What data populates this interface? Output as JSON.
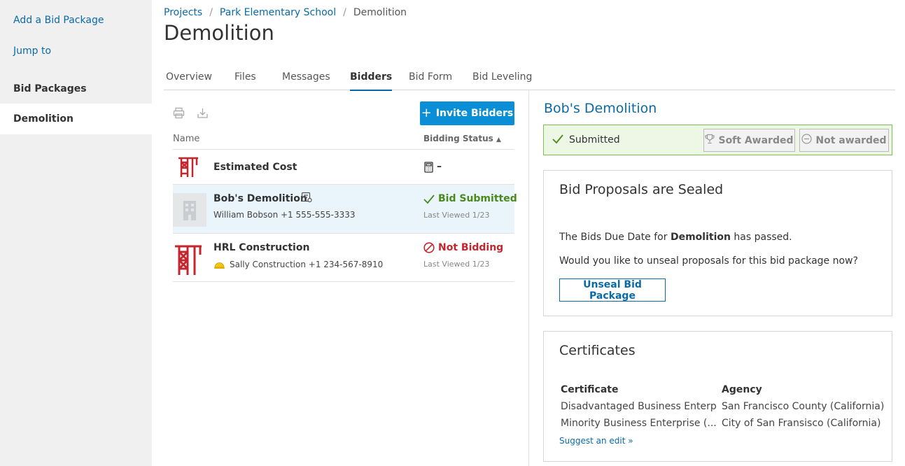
{
  "sidebar": {
    "add_link": "Add a Bid Package",
    "jump_link": "Jump to",
    "section_label": "Bid Packages",
    "active_item": "Demolition"
  },
  "breadcrumb": {
    "items": [
      "Projects",
      "Park Elementary School",
      "Demolition"
    ],
    "separator": "/"
  },
  "page_title": "Demolition",
  "tabs": [
    "Overview",
    "Files",
    "Messages",
    "Bidders",
    "Bid Form",
    "Bid Leveling"
  ],
  "active_tab": "Bidders",
  "toolbar": {
    "print_icon": "printer-icon",
    "download_icon": "download-icon",
    "invite_label": "Invite Bidders"
  },
  "table": {
    "col_name": "Name",
    "col_status": "Bidding Status",
    "estimated": {
      "name": "Estimated Cost",
      "value": "–"
    },
    "rows": [
      {
        "name": "Bob's Demolition",
        "contact": "William Bobson +1 555-555-3333",
        "status": "Bid Submitted",
        "last_viewed": "Last Viewed 1/23"
      },
      {
        "name": "HRL Construction",
        "contact": "Sally Construction +1 234-567-8910",
        "status": "Not Bidding",
        "last_viewed": "Last Viewed 1/23"
      }
    ]
  },
  "detail": {
    "title": "Bob's Demolition",
    "submission_status": "Submitted",
    "soft_award_label": "Soft Awarded",
    "not_awarded_label": "Not awarded",
    "sealed": {
      "title": "Bid Proposals are Sealed",
      "line1_prefix": "The Bids Due Date for ",
      "line1_bold": "Demolition",
      "line1_suffix": " has passed.",
      "line2": "Would you like to unseal proposals for this bid package now?",
      "button": "Unseal Bid Package"
    },
    "certificates": {
      "title": "Certificates",
      "head_certificate": "Certificate",
      "head_agency": "Agency",
      "rows": [
        {
          "certificate": "Disadvantaged Business Enterp...",
          "agency": "San Francisco County (California)"
        },
        {
          "certificate": "Minority Business Enterprise (...",
          "agency": "City of San Fransisco (California)"
        }
      ],
      "suggest_link": "Suggest an edit »"
    }
  },
  "colors": {
    "link": "#0a6aa8",
    "primary_button": "#0a8fd6",
    "success": "#4a8a1c",
    "danger": "#c4262e",
    "brand_red": "#c4262e"
  }
}
